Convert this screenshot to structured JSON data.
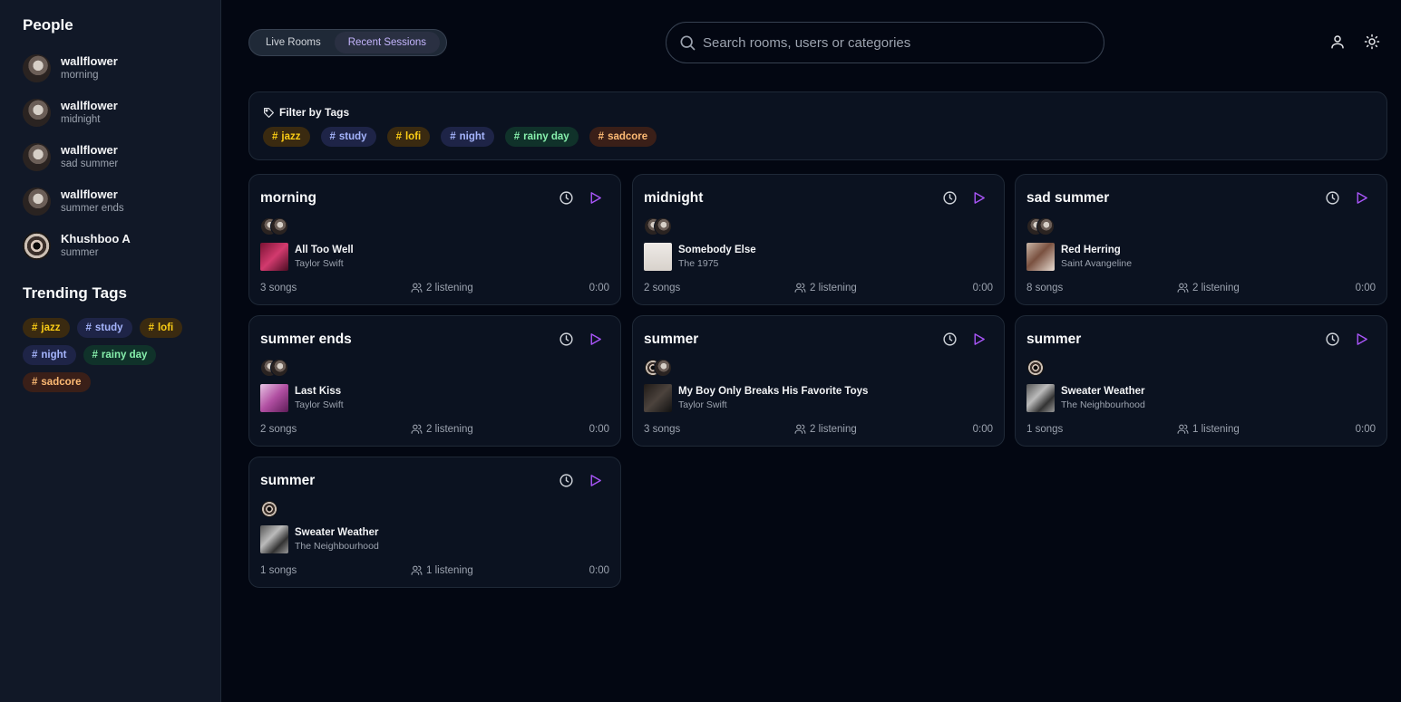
{
  "sidebar": {
    "people_heading": "People",
    "people": [
      {
        "name": "wallflower",
        "room": "morning"
      },
      {
        "name": "wallflower",
        "room": "midnight"
      },
      {
        "name": "wallflower",
        "room": "sad summer"
      },
      {
        "name": "wallflower",
        "room": "summer ends"
      },
      {
        "name": "Khushboo A",
        "room": "summer"
      }
    ],
    "trending_heading": "Trending Tags",
    "trending_tags": [
      "jazz",
      "study",
      "lofi",
      "night",
      "rainy day",
      "sadcore"
    ]
  },
  "header": {
    "tabs": [
      {
        "label": "Live Rooms",
        "active": false
      },
      {
        "label": "Recent Sessions",
        "active": true
      }
    ],
    "search_placeholder": "Search rooms, users or categories",
    "icons": [
      "user-icon",
      "sun-icon"
    ]
  },
  "filter": {
    "title": "Filter by Tags",
    "tags": [
      "jazz",
      "study",
      "lofi",
      "night",
      "rainy day",
      "sadcore"
    ]
  },
  "tag_symbol": "#",
  "colors": {
    "background": "#030712",
    "sidebar": "#111827",
    "accent": "#a855f7",
    "tag_yellow": "#facc15",
    "tag_indigo": "#a5b4fc",
    "tag_green": "#86efac",
    "tag_orange": "#fdba74"
  },
  "cards": [
    {
      "title": "morning",
      "song": "All Too Well",
      "artist": "Taylor Swift",
      "songs": "3 songs",
      "listening": "2 listening",
      "time": "0:00"
    },
    {
      "title": "midnight",
      "song": "Somebody Else",
      "artist": "The 1975",
      "songs": "2 songs",
      "listening": "2 listening",
      "time": "0:00"
    },
    {
      "title": "sad summer",
      "song": "Red Herring",
      "artist": "Saint Avangeline",
      "songs": "8 songs",
      "listening": "2 listening",
      "time": "0:00"
    },
    {
      "title": "summer ends",
      "song": "Last Kiss",
      "artist": "Taylor Swift",
      "songs": "2 songs",
      "listening": "2 listening",
      "time": "0:00"
    },
    {
      "title": "summer",
      "song": "My Boy Only Breaks His Favorite Toys",
      "artist": "Taylor Swift",
      "songs": "3 songs",
      "listening": "2 listening",
      "time": "0:00"
    },
    {
      "title": "summer",
      "song": "Sweater Weather",
      "artist": "The Neighbourhood",
      "songs": "1 songs",
      "listening": "1 listening",
      "time": "0:00"
    },
    {
      "title": "summer",
      "song": "Sweater Weather",
      "artist": "The Neighbourhood",
      "songs": "1 songs",
      "listening": "1 listening",
      "time": "0:00"
    }
  ]
}
